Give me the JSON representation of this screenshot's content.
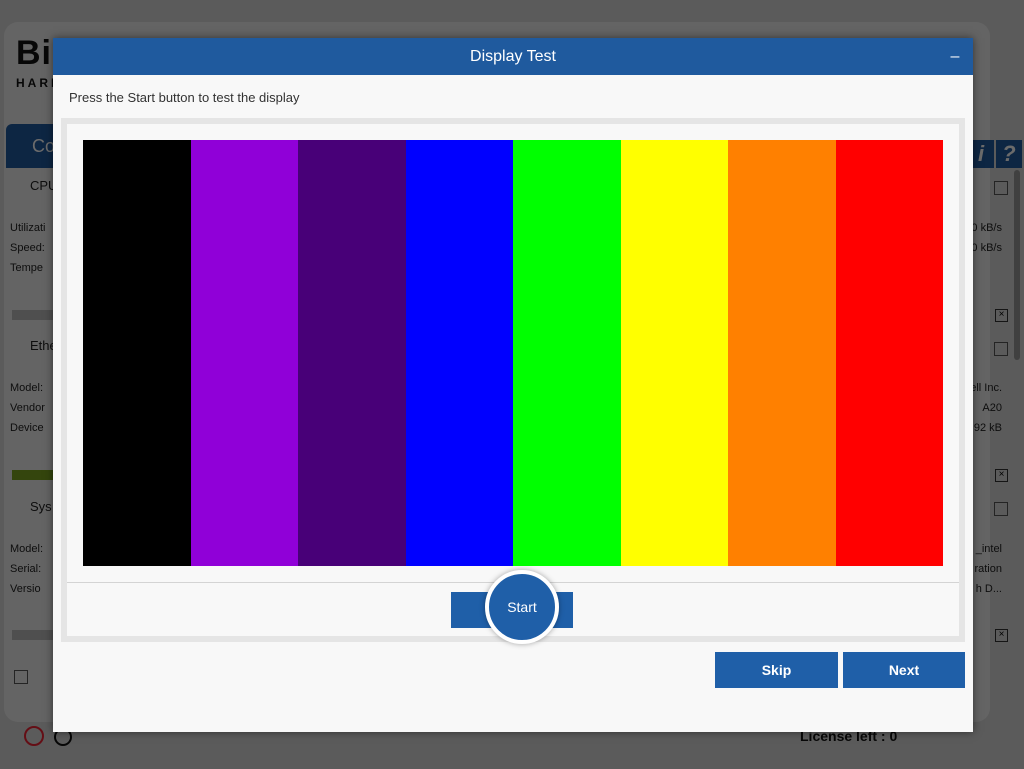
{
  "background": {
    "logo_big": "Bi",
    "logo_small": "HARD",
    "tab_label": "Co",
    "info_buttons": [
      "i",
      "?"
    ],
    "sections": [
      {
        "title": "CPU",
        "fields_left": [
          "Utilizati",
          "Speed:",
          "Tempe"
        ],
        "fields_right": [
          "0 kB/s",
          "0 kB/s",
          ""
        ]
      },
      {
        "title": "Ethe",
        "fields_left": [
          "Model:",
          "Vendor",
          "Device"
        ],
        "fields_right": [
          "ell Inc.",
          "A20",
          "92 kB"
        ]
      },
      {
        "title": "Sys",
        "fields_left": [
          "Model:",
          "Serial:",
          "Versio"
        ],
        "fields_right": [
          "_intel",
          "ration",
          "h D..."
        ]
      }
    ],
    "license_label": "License left : 0"
  },
  "dialog": {
    "title": "Display Test",
    "minimize_label": "–",
    "instruction": "Press the Start button to test the display",
    "stripe_colors": [
      "#000000",
      "#9000d8",
      "#480078",
      "#0000ff",
      "#00ff00",
      "#ffff00",
      "#ff8000",
      "#ff0000"
    ],
    "start_label": "Start",
    "skip_label": "Skip",
    "next_label": "Next"
  }
}
